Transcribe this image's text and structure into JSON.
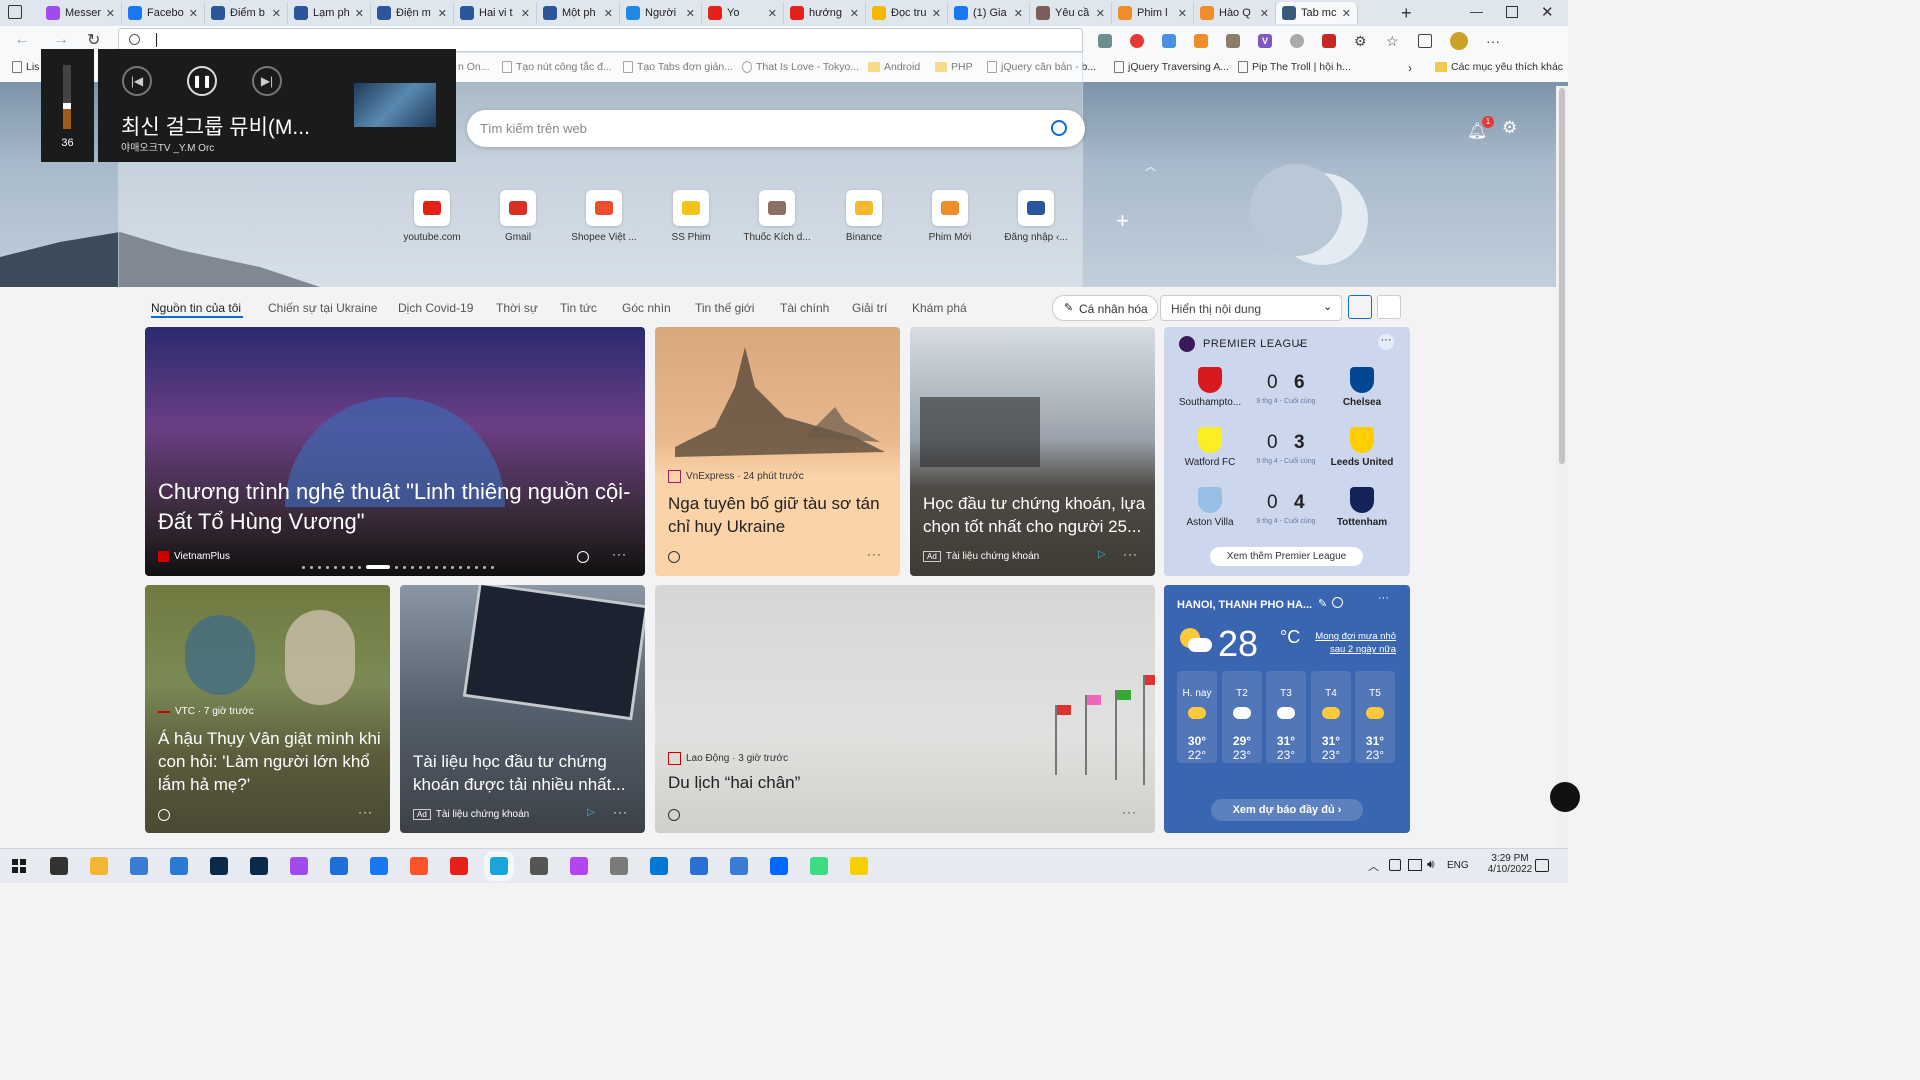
{
  "tabs": [
    {
      "title": "Messer",
      "icon": "messenger-icon",
      "color": "#a04bf0"
    },
    {
      "title": "Facebo",
      "icon": "facebook-icon",
      "color": "#1877f2"
    },
    {
      "title": "Điểm b",
      "icon": "w-doc-icon",
      "color": "#2b579a"
    },
    {
      "title": "Lạm ph",
      "icon": "w-doc-icon",
      "color": "#2b579a"
    },
    {
      "title": "Điện m",
      "icon": "w-doc-icon",
      "color": "#2b579a"
    },
    {
      "title": "Hai vi t",
      "icon": "w-doc-icon",
      "color": "#2b579a"
    },
    {
      "title": "Một ph",
      "icon": "w-doc-icon",
      "color": "#2b579a"
    },
    {
      "title": "Người",
      "icon": "tm-icon",
      "color": "#1e88e5"
    },
    {
      "title": "Yo",
      "icon": "youtube-icon",
      "color": "#e62117"
    },
    {
      "title": "hướng",
      "icon": "youtube-icon",
      "color": "#e62117"
    },
    {
      "title": "Đọc tru",
      "icon": "n-icon",
      "color": "#f5b800"
    },
    {
      "title": "(1) Gia",
      "icon": "facebook-icon",
      "color": "#1877f2"
    },
    {
      "title": "Yêu cầ",
      "icon": "globe-icon",
      "color": "#7b5e57"
    },
    {
      "title": "Phim l",
      "icon": "hand-icon",
      "color": "#f08c2a"
    },
    {
      "title": "Hào Q",
      "icon": "hand-icon",
      "color": "#f08c2a"
    },
    {
      "title": "Tab mc",
      "icon": "newtab-icon",
      "color": "#3a5a7a"
    }
  ],
  "omnibox": {
    "value": ""
  },
  "bookmarks": [
    {
      "label": "Lis"
    },
    {
      "label": "n On..."
    },
    {
      "label": "Tạo nút công tắc đ..."
    },
    {
      "label": "Tạo Tabs đơn giản..."
    },
    {
      "label": "That Is Love - Tokyo..."
    },
    {
      "label": "Android"
    },
    {
      "label": "PHP"
    },
    {
      "label": "jQuery căn bản - b..."
    },
    {
      "label": "jQuery Traversing A..."
    },
    {
      "label": "Pip The Troll | hội h..."
    },
    {
      "label": "Các mục yêu thích khác"
    }
  ],
  "media": {
    "volume": "36",
    "volume_level": 0.36,
    "title": "최신 걸그룹 뮤비(M...",
    "artist": "야매오크TV _Y.M Orc"
  },
  "search": {
    "placeholder": "Tìm kiếm trên web"
  },
  "notifications": {
    "count": "1"
  },
  "quicklinks": [
    {
      "label": "youtube.com",
      "icon": "youtube-icon",
      "color": "#e62117"
    },
    {
      "label": "Gmail",
      "icon": "gmail-icon",
      "color": "#d93025"
    },
    {
      "label": "Shopee Việt ...",
      "icon": "shopee-icon",
      "color": "#ee4d2d"
    },
    {
      "label": "SS Phim",
      "icon": "tv-icon",
      "color": "#f0c419"
    },
    {
      "label": "Thuốc Kích d...",
      "icon": "image-icon",
      "color": "#8d6e63"
    },
    {
      "label": "Binance",
      "icon": "binance-icon",
      "color": "#f3ba2f"
    },
    {
      "label": "Phim Mới",
      "icon": "hand-icon",
      "color": "#f08c2a"
    },
    {
      "label": "Đăng nhập ‹...",
      "icon": "w-doc-icon",
      "color": "#2b579a"
    }
  ],
  "feed_nav": {
    "items": [
      "Nguồn tin của tôi",
      "Chiến sự tại Ukraine",
      "Dịch Covid-19",
      "Thời sự",
      "Tin tức",
      "Góc nhìn",
      "Tin thế giới",
      "Tài chính",
      "Giải trí",
      "Khám phá"
    ],
    "personalize": "Cá nhân hóa",
    "content_select": "Hiển thị nội dung"
  },
  "cards": [
    {
      "title": "Chương trình nghệ thuật \"Linh thiêng nguồn cội-Đất Tổ Hùng Vương\"",
      "source": "VietnamPlus"
    },
    {
      "title": "Nga tuyên bố giữ tàu sơ tán chỉ huy Ukraine",
      "source": "VnExpress · 24 phút trước"
    },
    {
      "title": "Học đầu tư chứng khoán, lựa chọn tốt nhất cho người 25...",
      "source": "Tài liệu chứng khoán",
      "ad": "Ad"
    },
    {
      "title": "Á hậu Thụy Vân giật mình khi con hỏi: 'Làm người lớn khổ lắm hả mẹ?'",
      "source": "VTC · 7 giờ trước"
    },
    {
      "title": "Tài liệu học đầu tư chứng khoán được tải nhiều nhất...",
      "source": "Tài liệu chứng khoán",
      "ad": "Ad"
    },
    {
      "title": "Du lịch “hai chân”",
      "source": "Lao Động · 3 giờ trước"
    }
  ],
  "sports": {
    "league": "PREMIER LEAGUE",
    "matches": [
      {
        "home": "Southampto...",
        "away": "Chelsea",
        "home_score": "0",
        "away_score": "6",
        "status": "9 thg 4 - Cuối cùng"
      },
      {
        "home": "Watford FC",
        "away": "Leeds United",
        "home_score": "0",
        "away_score": "3",
        "status": "9 thg 4 - Cuối cùng"
      },
      {
        "home": "Aston Villa",
        "away": "Tottenham",
        "home_score": "0",
        "away_score": "4",
        "status": "9 thg 4 - Cuối cùng"
      }
    ],
    "more": "Xem thêm Premier League"
  },
  "weather": {
    "location": "HANOI, THANH PHO HA...",
    "temp": "28",
    "unit": "°C",
    "note": "Mong đợi mưa nhỏ sau 2 ngày nữa",
    "days": [
      {
        "label": "H. nay",
        "high": "30°",
        "low": "22°",
        "icon": "partly-sunny-icon"
      },
      {
        "label": "T2",
        "high": "29°",
        "low": "23°",
        "icon": "cloud-icon"
      },
      {
        "label": "T3",
        "high": "31°",
        "low": "23°",
        "icon": "cloud-icon"
      },
      {
        "label": "T4",
        "high": "31°",
        "low": "23°",
        "icon": "partly-sunny-icon"
      },
      {
        "label": "T5",
        "high": "31°",
        "low": "23°",
        "icon": "partly-sunny-icon"
      }
    ],
    "forecast": "Xem dự báo đầy đủ ›"
  },
  "taskbar": {
    "apps": [
      {
        "name": "task-view-icon",
        "color": "#333"
      },
      {
        "name": "file-explorer-icon",
        "color": "#f2b632"
      },
      {
        "name": "store-icon",
        "color": "#3a7bd5"
      },
      {
        "name": "mail-icon",
        "color": "#2a7ad5"
      },
      {
        "name": "photoshop-icon",
        "color": "#0b2a4a"
      },
      {
        "name": "lightroom-icon",
        "color": "#0b2a4a"
      },
      {
        "name": "messenger-icon",
        "color": "#a04bf0"
      },
      {
        "name": "maps-icon",
        "color": "#1e6fd9"
      },
      {
        "name": "facebook-icon",
        "color": "#1877f2"
      },
      {
        "name": "brave-icon",
        "color": "#fb542b"
      },
      {
        "name": "youtube-icon",
        "color": "#e62117"
      },
      {
        "name": "edge-icon",
        "color": "#1aa5d8"
      },
      {
        "name": "unity-icon",
        "color": "#555"
      },
      {
        "name": "phpstorm-icon",
        "color": "#b345f1"
      },
      {
        "name": "app-icon",
        "color": "#7a7a7a"
      },
      {
        "name": "vscode-icon",
        "color": "#0078d4"
      },
      {
        "name": "monitor-icon",
        "color": "#2a6fd6"
      },
      {
        "name": "translate-icon",
        "color": "#3a7bd5"
      },
      {
        "name": "zalo-icon",
        "color": "#0068ff"
      },
      {
        "name": "android-studio-icon",
        "color": "#3ddc84"
      },
      {
        "name": "sticky-notes-icon",
        "color": "#f7d000"
      }
    ],
    "lang": "ENG",
    "time": "3:29 PM",
    "date": "4/10/2022"
  }
}
